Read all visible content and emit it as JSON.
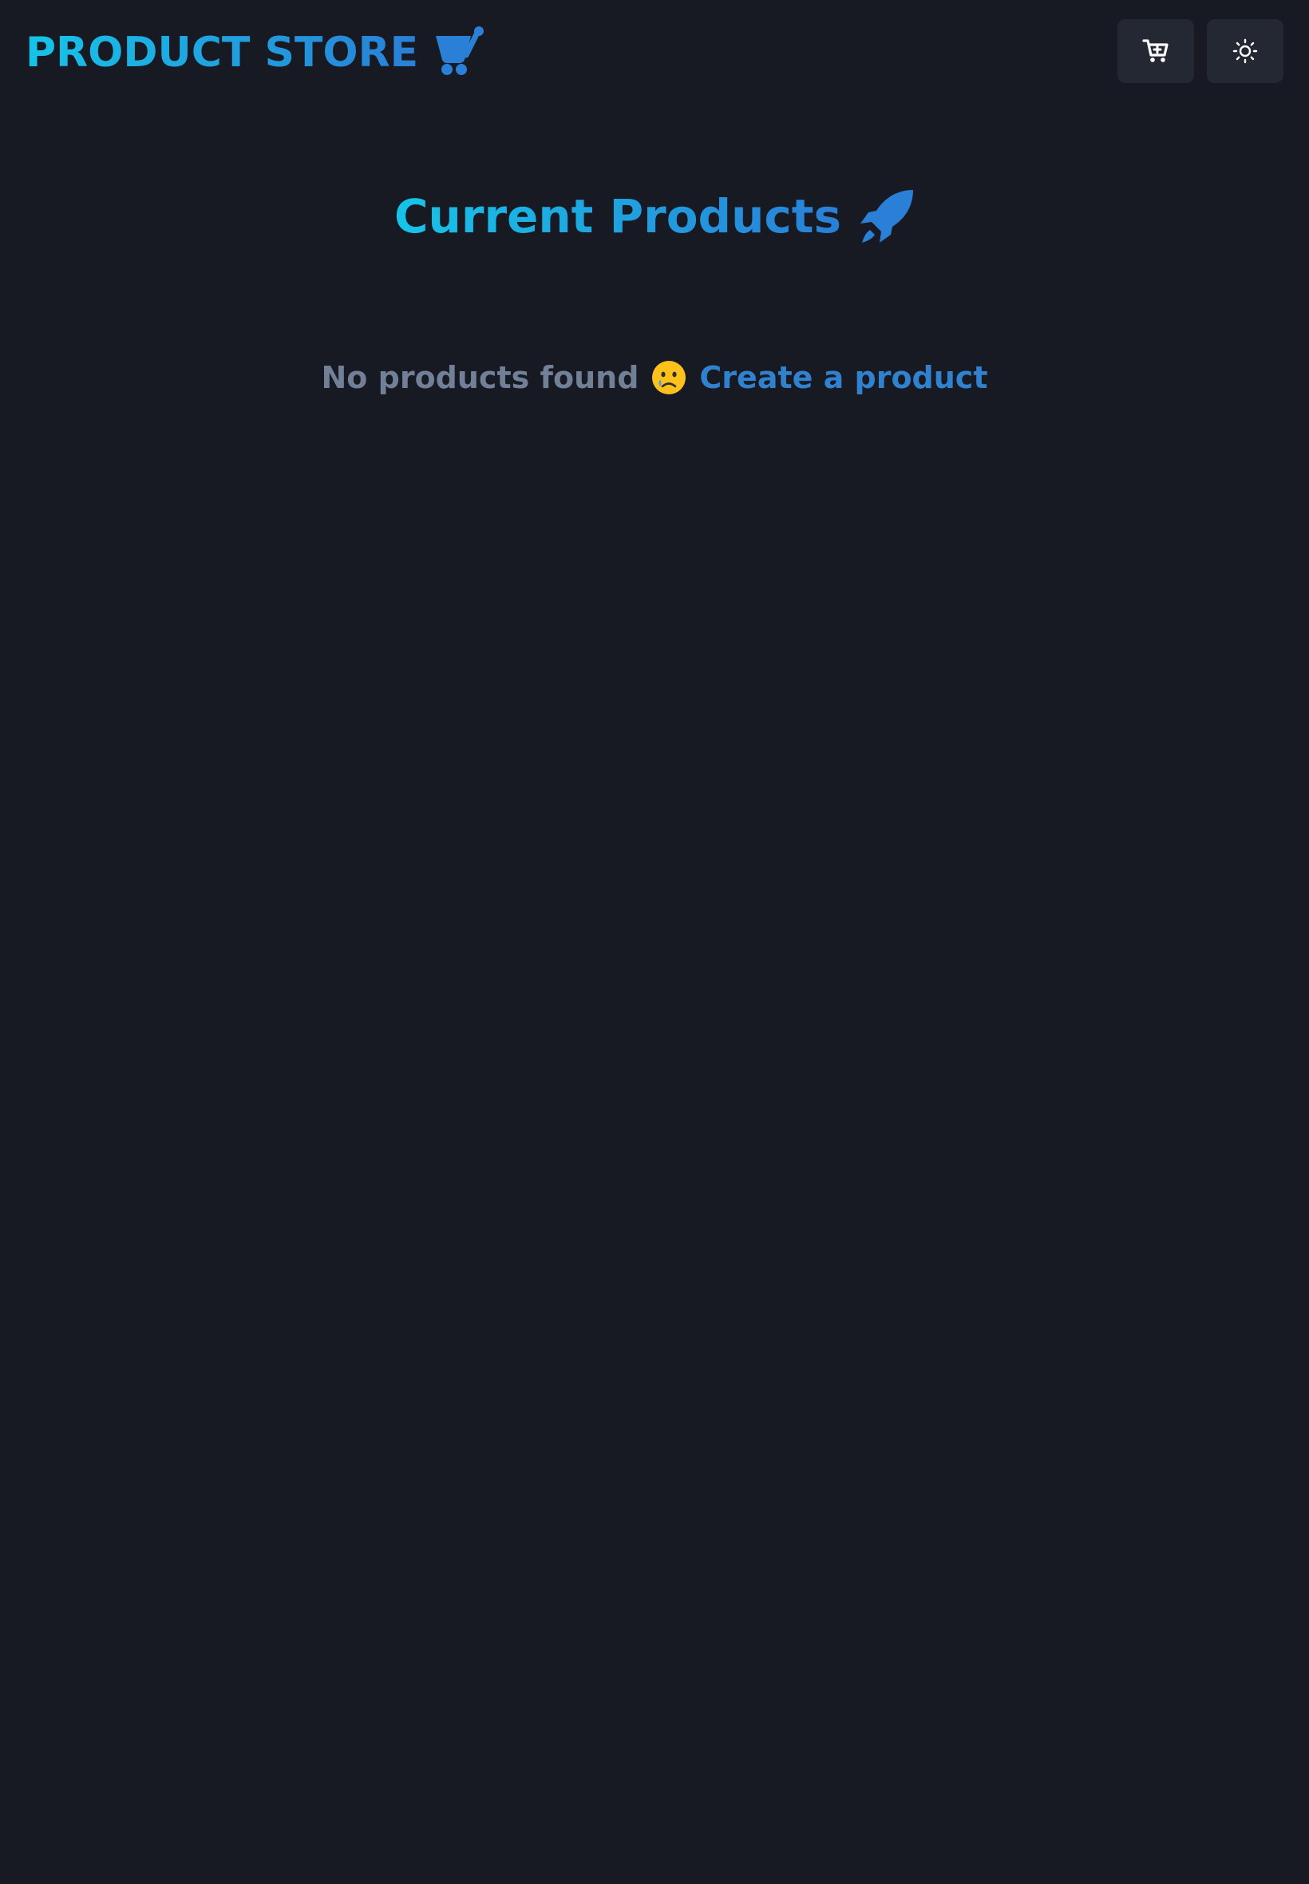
{
  "navbar": {
    "brand_label": "PRODUCT STORE",
    "brand_icon": "shopping-cart-icon",
    "create_button_icon": "cart-plus-icon",
    "theme_toggle_icon": "sun-icon"
  },
  "main": {
    "heading": "Current Products",
    "heading_icon": "rocket-icon",
    "empty_message": "No products found",
    "empty_icon": "sad-face-icon",
    "create_link_label": "Create a product"
  },
  "colors": {
    "background": "#171a23",
    "button_background": "#242833",
    "gradient_start": "#16c4e8",
    "gradient_end": "#2a7fd6",
    "muted_text": "#718096",
    "link": "#3182ce"
  }
}
